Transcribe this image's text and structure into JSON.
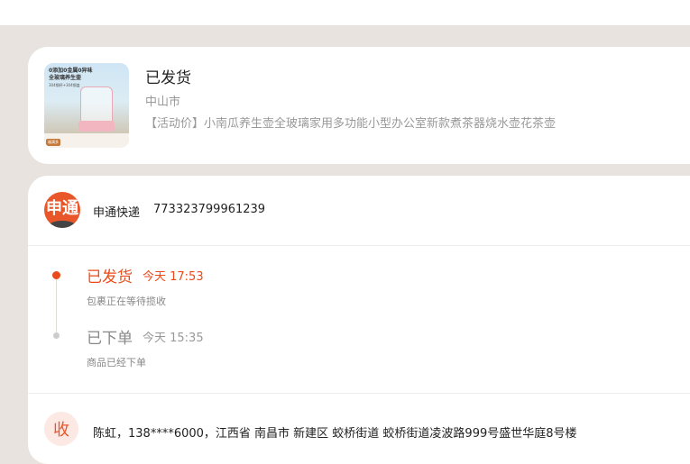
{
  "order": {
    "status": "已发货",
    "city": "中山市",
    "product_name": "【活动价】小南瓜养生壶全玻璃家用多功能小型办公室新款煮茶器烧水壶花茶壶",
    "thumbnail": {
      "headline": "0添加0金属0异味",
      "subline": "全玻璃养生壶",
      "small": "304钢杯+304钢盖",
      "badge": "福满多"
    }
  },
  "logistics": {
    "courier_logo": "申通",
    "courier_name": "申通快递",
    "tracking_number": "773323799961239",
    "events": [
      {
        "title": "已发货",
        "time": "今天 17:53",
        "desc": "包裹正在等待揽收",
        "active": true
      },
      {
        "title": "已下单",
        "time": "今天 15:35",
        "desc": "商品已经下单",
        "active": false
      }
    ]
  },
  "address": {
    "icon_label": "收",
    "text": "陈虹，138****6000，江西省 南昌市 新建区 蛟桥街道 蛟桥街道凌波路999号盛世华庭8号楼"
  },
  "colors": {
    "accent": "#ea4a1c",
    "background": "#e8e3de",
    "muted": "#999999"
  }
}
